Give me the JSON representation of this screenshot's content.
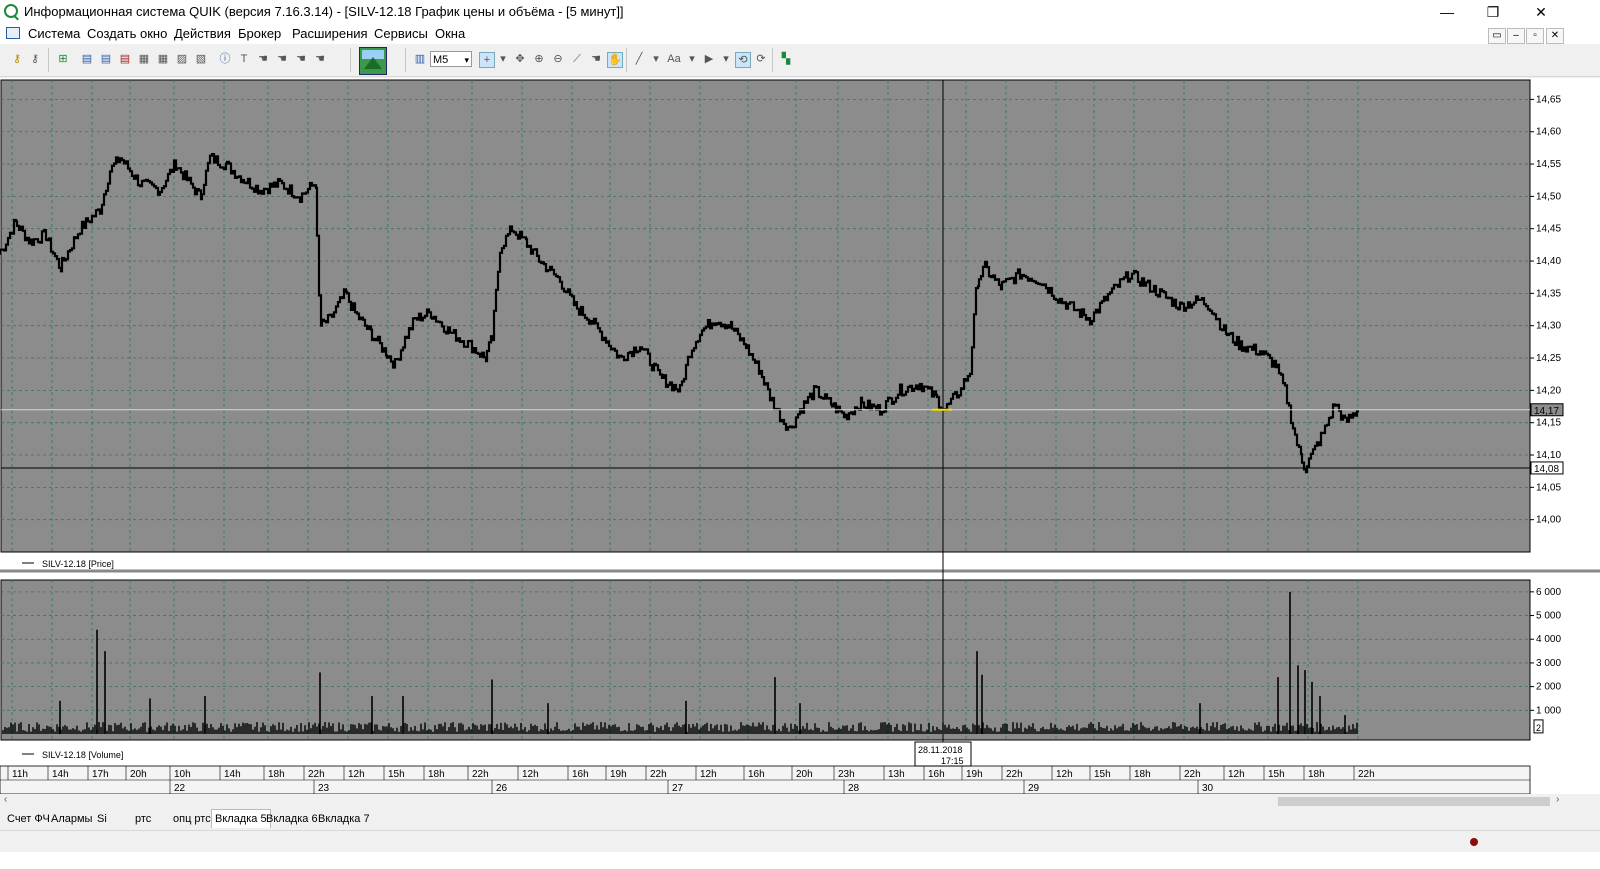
{
  "window": {
    "title": "Информационная система QUIK (версия 7.16.3.14) - [SILV-12.18 График цены и объёма - [5 минут]]",
    "minimize": "—",
    "restore": "❐",
    "close": "✕"
  },
  "menu": {
    "items": [
      "Система",
      "Создать окно",
      "Действия",
      "Брокер",
      "Расширения",
      "Сервисы",
      "Окна"
    ],
    "mdi_buttons": [
      "▭",
      "–",
      "▫",
      "✕"
    ]
  },
  "toolbar": {
    "interval": "M5"
  },
  "price_panel": {
    "label": "SILV-12.18 [Price]",
    "current_price": "14,17",
    "crosshair_price": "14,08"
  },
  "volume_panel": {
    "label": "SILV-12.18 [Volume]",
    "marker": "2"
  },
  "crosshair": {
    "date": "28.11.2018",
    "time": "17:15"
  },
  "tabs": [
    "Счет ФЧ",
    "Алармы",
    "Si",
    "ртс",
    "опц ртс",
    "Вкладка 5",
    "Вкладка 6",
    "Вкладка 7"
  ],
  "active_tab": "Вкладка 5",
  "chart_data": [
    {
      "type": "line",
      "series": [
        {
          "name": "SILV-12.18 [Price]"
        }
      ],
      "y_ticks": [
        "14,65",
        "14,60",
        "14,55",
        "14,50",
        "14,45",
        "14,40",
        "14,35",
        "14,30",
        "14,25",
        "14,20",
        "14,15",
        "14,10",
        "14,05",
        "14,00"
      ],
      "ylim": [
        13.95,
        14.68
      ],
      "grid": true,
      "x_points": [
        0,
        15,
        30,
        45,
        60,
        80,
        100,
        110,
        120,
        140,
        160,
        175,
        185,
        200,
        210,
        225,
        240,
        260,
        280,
        300,
        315,
        320,
        330,
        345,
        355,
        370,
        385,
        395,
        405,
        415,
        430,
        450,
        470,
        485,
        492,
        500,
        512,
        525,
        540,
        560,
        575,
        590,
        605,
        620,
        640,
        660,
        680,
        690,
        700,
        715,
        730,
        745,
        760,
        770,
        780,
        790,
        800,
        815,
        830,
        845,
        860,
        880,
        900,
        920,
        935,
        945,
        960,
        970,
        977,
        985,
        1000,
        1020,
        1040,
        1060,
        1080,
        1090,
        1110,
        1130,
        1140,
        1160,
        1180,
        1200,
        1210,
        1225,
        1240,
        1260,
        1275,
        1285,
        1295,
        1300,
        1305,
        1315,
        1325,
        1335,
        1345,
        1358
      ],
      "values": [
        14.41,
        14.46,
        14.43,
        14.44,
        14.39,
        14.45,
        14.48,
        14.54,
        14.56,
        14.52,
        14.51,
        14.55,
        14.53,
        14.5,
        14.56,
        14.55,
        14.53,
        14.51,
        14.52,
        14.5,
        14.52,
        14.3,
        14.31,
        14.35,
        14.32,
        14.29,
        14.26,
        14.24,
        14.28,
        14.31,
        14.32,
        14.29,
        14.27,
        14.25,
        14.28,
        14.42,
        14.45,
        14.43,
        14.4,
        14.37,
        14.33,
        14.31,
        14.28,
        14.25,
        14.27,
        14.22,
        14.2,
        14.26,
        14.29,
        14.31,
        14.3,
        14.27,
        14.23,
        14.19,
        14.16,
        14.14,
        14.17,
        14.2,
        14.18,
        14.16,
        14.18,
        14.17,
        14.2,
        14.21,
        14.19,
        14.17,
        14.2,
        14.23,
        14.37,
        14.39,
        14.36,
        14.38,
        14.37,
        14.34,
        14.32,
        14.31,
        14.35,
        14.38,
        14.37,
        14.35,
        14.33,
        14.34,
        14.33,
        14.29,
        14.27,
        14.26,
        14.24,
        14.2,
        14.13,
        14.1,
        14.08,
        14.11,
        14.14,
        14.18,
        14.15,
        14.17
      ]
    },
    {
      "type": "bar",
      "series": [
        {
          "name": "SILV-12.18 [Volume]"
        }
      ],
      "y_ticks": [
        "6 000",
        "5 000",
        "4 000",
        "3 000",
        "2 000",
        "1 000"
      ],
      "ylim": [
        0,
        6500
      ],
      "grid": true,
      "spikes": [
        {
          "x": 97,
          "v": 4400
        },
        {
          "x": 105,
          "v": 3500
        },
        {
          "x": 60,
          "v": 1400
        },
        {
          "x": 150,
          "v": 1500
        },
        {
          "x": 205,
          "v": 1600
        },
        {
          "x": 320,
          "v": 2600
        },
        {
          "x": 372,
          "v": 1600
        },
        {
          "x": 403,
          "v": 1600
        },
        {
          "x": 492,
          "v": 2300
        },
        {
          "x": 548,
          "v": 1300
        },
        {
          "x": 686,
          "v": 1400
        },
        {
          "x": 775,
          "v": 2400
        },
        {
          "x": 800,
          "v": 1300
        },
        {
          "x": 977,
          "v": 3500
        },
        {
          "x": 982,
          "v": 2500
        },
        {
          "x": 1200,
          "v": 1300
        },
        {
          "x": 1278,
          "v": 2400
        },
        {
          "x": 1290,
          "v": 6000
        },
        {
          "x": 1298,
          "v": 2900
        },
        {
          "x": 1305,
          "v": 2700
        },
        {
          "x": 1312,
          "v": 2200
        },
        {
          "x": 1320,
          "v": 1600
        },
        {
          "x": 1345,
          "v": 800
        }
      ],
      "base_level": 300
    }
  ],
  "time_axis": {
    "hours": [
      {
        "x": 12,
        "t": "11h"
      },
      {
        "x": 52,
        "t": "14h"
      },
      {
        "x": 92,
        "t": "17h"
      },
      {
        "x": 130,
        "t": "20h"
      },
      {
        "x": 174,
        "t": "10h"
      },
      {
        "x": 224,
        "t": "14h"
      },
      {
        "x": 268,
        "t": "18h"
      },
      {
        "x": 308,
        "t": "22h"
      },
      {
        "x": 348,
        "t": "12h"
      },
      {
        "x": 388,
        "t": "15h"
      },
      {
        "x": 428,
        "t": "18h"
      },
      {
        "x": 472,
        "t": "22h"
      },
      {
        "x": 522,
        "t": "12h"
      },
      {
        "x": 572,
        "t": "16h"
      },
      {
        "x": 610,
        "t": "19h"
      },
      {
        "x": 650,
        "t": "22h"
      },
      {
        "x": 700,
        "t": "12h"
      },
      {
        "x": 748,
        "t": "16h"
      },
      {
        "x": 796,
        "t": "20h"
      },
      {
        "x": 838,
        "t": "23h"
      },
      {
        "x": 888,
        "t": "13h"
      },
      {
        "x": 928,
        "t": "16h"
      },
      {
        "x": 966,
        "t": "19h"
      },
      {
        "x": 1006,
        "t": "22h"
      },
      {
        "x": 1056,
        "t": "12h"
      },
      {
        "x": 1094,
        "t": "15h"
      },
      {
        "x": 1134,
        "t": "18h"
      },
      {
        "x": 1184,
        "t": "22h"
      },
      {
        "x": 1228,
        "t": "12h"
      },
      {
        "x": 1268,
        "t": "15h"
      },
      {
        "x": 1308,
        "t": "18h"
      },
      {
        "x": 1358,
        "t": "22h"
      }
    ],
    "days": [
      {
        "x": 174,
        "t": "22"
      },
      {
        "x": 318,
        "t": "23"
      },
      {
        "x": 496,
        "t": "26"
      },
      {
        "x": 672,
        "t": "27"
      },
      {
        "x": 848,
        "t": "28"
      },
      {
        "x": 1028,
        "t": "29"
      },
      {
        "x": 1202,
        "t": "30"
      }
    ]
  }
}
